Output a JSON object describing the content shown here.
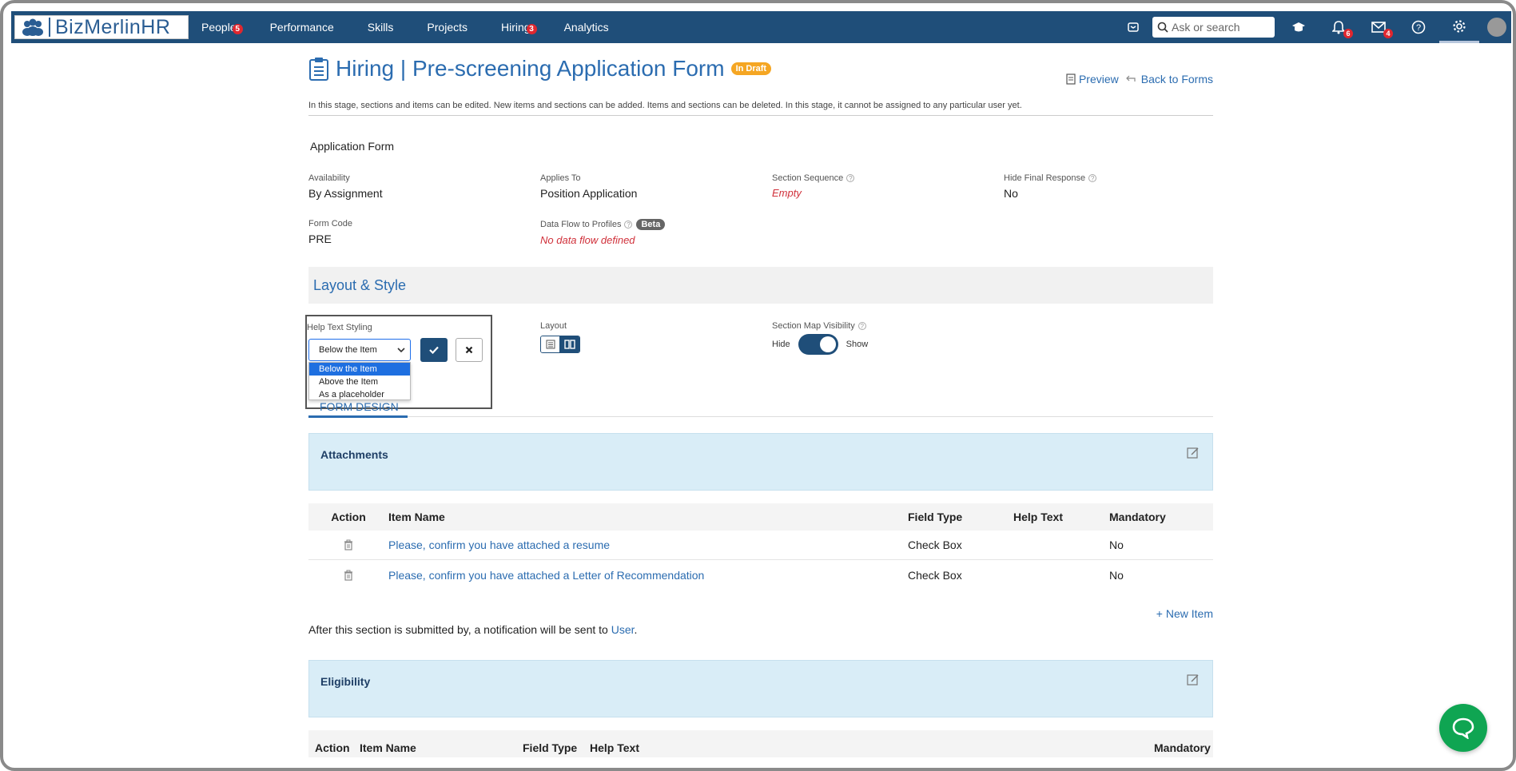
{
  "brand": {
    "name": "BizMerlinHR"
  },
  "nav": {
    "items": [
      {
        "label": "People",
        "badge": "5"
      },
      {
        "label": "Performance",
        "badge": ""
      },
      {
        "label": "Skills",
        "badge": ""
      },
      {
        "label": "Projects",
        "badge": ""
      },
      {
        "label": "Hiring",
        "badge": "3"
      },
      {
        "label": "Analytics",
        "badge": ""
      }
    ],
    "search_placeholder": "Ask or search",
    "notification_badge": "6",
    "mail_badge": "4"
  },
  "page": {
    "title": "Hiring | Pre-screening Application Form",
    "status": "In Draft",
    "preview_label": "Preview",
    "back_label": "Back to Forms",
    "description": "In this stage, sections and items can be edited. New items and sections can be added. Items and sections can be deleted. In this stage, it cannot be assigned to any particular user yet.",
    "section_name": "Application Form"
  },
  "meta": {
    "availability_label": "Availability",
    "availability_value": "By Assignment",
    "applies_label": "Applies To",
    "applies_value": "Position Application",
    "sequence_label": "Section Sequence",
    "sequence_value": "Empty",
    "hide_label": "Hide Final Response",
    "hide_value": "No",
    "code_label": "Form Code",
    "code_value": "PRE",
    "flow_label": "Data Flow to Profiles",
    "flow_badge": "Beta",
    "flow_value": "No data flow defined"
  },
  "layout_style": {
    "title": "Layout & Style",
    "help_label": "Help Text Styling",
    "help_value": "Below the Item",
    "help_options": [
      "Below the Item",
      "Above the Item",
      "As a placeholder"
    ],
    "layout_label": "Layout",
    "smv_label": "Section Map Visibility",
    "hide": "Hide",
    "show": "Show"
  },
  "form_design": {
    "tab": "FORM DESIGN"
  },
  "sections": [
    {
      "title": "Attachments",
      "columns": [
        "Action",
        "Item Name",
        "Field Type",
        "Help Text",
        "Mandatory"
      ],
      "rows": [
        {
          "name": "Please, confirm you have attached a resume",
          "type": "Check Box",
          "help": "",
          "mandatory": "No"
        },
        {
          "name": "Please, confirm you have attached a Letter of Recommendation",
          "type": "Check Box",
          "help": "",
          "mandatory": "No"
        }
      ],
      "new_item": "+ New Item",
      "notify_prefix": "After this section is submitted by, a notification will be sent to",
      "notify_link": "User",
      "notify_suffix": "."
    },
    {
      "title": "Eligibility",
      "columns": [
        "Action",
        "Item Name",
        "Field Type",
        "Help Text",
        "Mandatory"
      ]
    }
  ],
  "colors": {
    "nav_bg": "#1f4e79",
    "accent": "#2b6cb0",
    "draft": "#f5a623",
    "chat": "#0fa552"
  }
}
